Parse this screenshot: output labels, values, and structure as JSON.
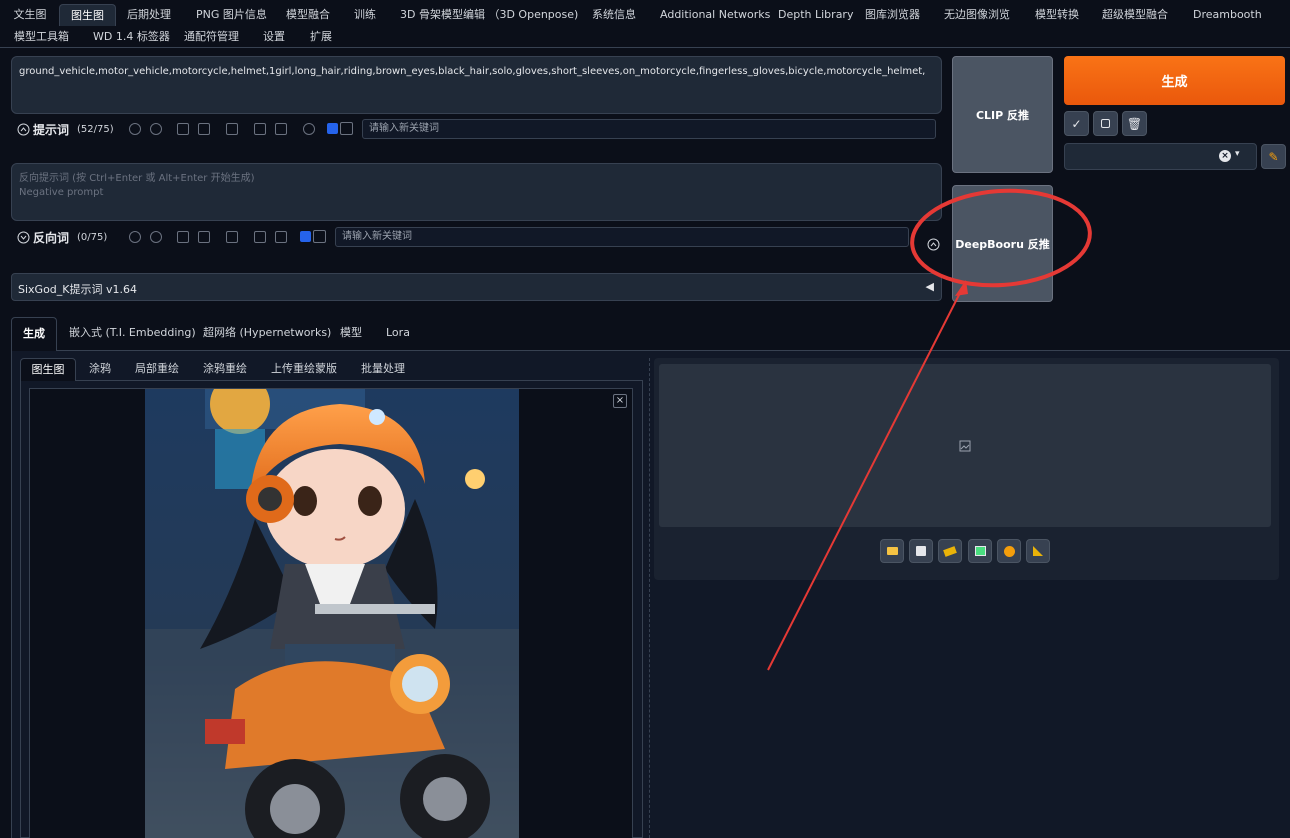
{
  "topnav": {
    "row1": [
      "文生图",
      "图生图",
      "后期处理",
      "PNG 图片信息",
      "模型融合",
      "训练",
      "3D 骨架模型编辑 （3D Openpose)",
      "系统信息",
      "Additional Networks",
      "Depth Library",
      "图库浏览器",
      "无边图像浏览",
      "模型转换",
      "超级模型融合",
      "Dreambooth"
    ],
    "row2": [
      "模型工具箱",
      "WD 1.4 标签器",
      "通配符管理",
      "设置",
      "扩展"
    ]
  },
  "prompt": {
    "text": "ground_vehicle,motor_vehicle,motorcycle,helmet,1girl,long_hair,riding,brown_eyes,black_hair,solo,gloves,short_sleeves,on_motorcycle,fingerless_gloves,bicycle,motorcycle_helmet,",
    "label": "提示词",
    "count": "(52/75)",
    "keyword_placeholder": "请输入新关键词"
  },
  "negative": {
    "placeholder_line1": "反向提示词 (按 Ctrl+Enter 或 Alt+Enter 开始生成)",
    "placeholder_line2": "Negative prompt",
    "label": "反向词",
    "count": "(0/75)",
    "keyword_placeholder": "请输入新关键词"
  },
  "buttons": {
    "clip": "CLIP 反推",
    "deepbooru": "DeepBooru 反推",
    "generate": "生成"
  },
  "sixgod": {
    "label": "SixGod_K提示词 v1.64",
    "arrow": "◀"
  },
  "main_tabs": [
    "生成",
    "嵌入式 (T.I. Embedding)",
    "超网络 (Hypernetworks)",
    "模型",
    "Lora"
  ],
  "img_tabs": [
    "图生图",
    "涂鸦",
    "局部重绘",
    "涂鸦重绘",
    "上传重绘蒙版",
    "批量处理"
  ],
  "colors": {
    "accent": "#f97316",
    "annotation": "#e53935",
    "bg": "#0b0f19",
    "panel": "#1f2937"
  },
  "icons": {
    "output_tools": [
      "folder-icon",
      "save-icon",
      "zip-icon",
      "image-icon",
      "palette-icon",
      "ruler-icon"
    ],
    "style_tools": [
      "check-icon",
      "square-icon",
      "trash-icon"
    ]
  }
}
